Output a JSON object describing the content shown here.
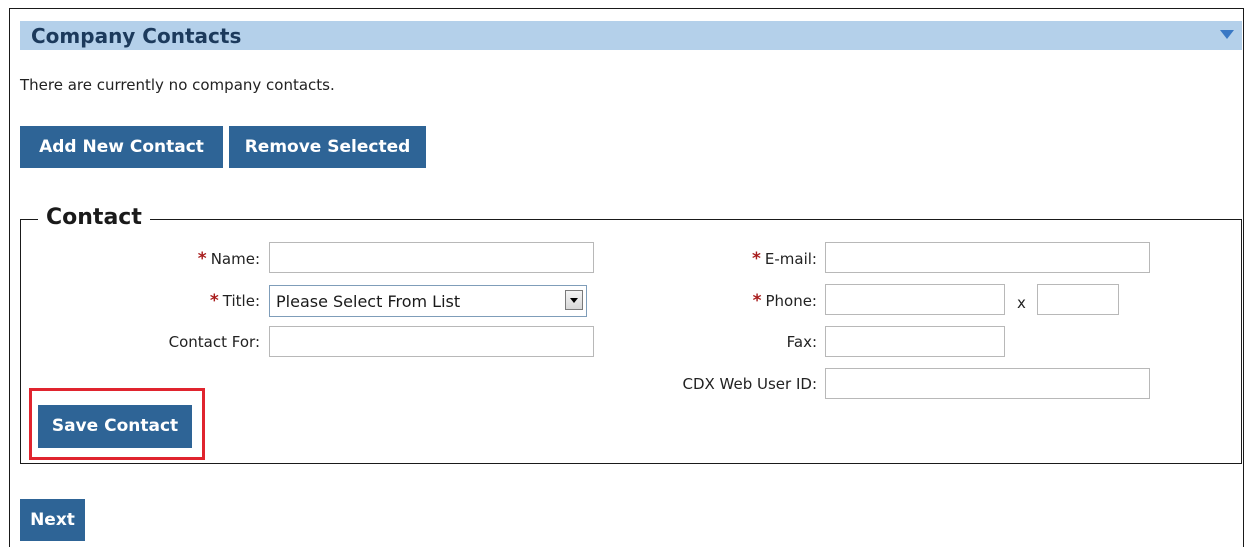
{
  "header": {
    "title": "Company Contacts",
    "collapse_icon": "triangle-down-icon"
  },
  "info_text": "There are currently no company contacts.",
  "toolbar": {
    "add_label": "Add New Contact",
    "remove_label": "Remove Selected"
  },
  "contact_form": {
    "legend": "Contact",
    "name_label": "Name:",
    "title_label": "Title:",
    "title_selected": "Please Select From List",
    "contact_for_label": "Contact For:",
    "email_label": "E-mail:",
    "phone_label": "Phone:",
    "extension_label": "x",
    "fax_label": "Fax:",
    "cdx_label": "CDX Web User ID:",
    "required_marker": "*",
    "save_label": "Save Contact"
  },
  "next_label": "Next",
  "colors": {
    "header_bg": "#b4d0ea",
    "button_bg": "#2e6496",
    "required": "#a81c1c",
    "highlight": "#e0242e"
  }
}
